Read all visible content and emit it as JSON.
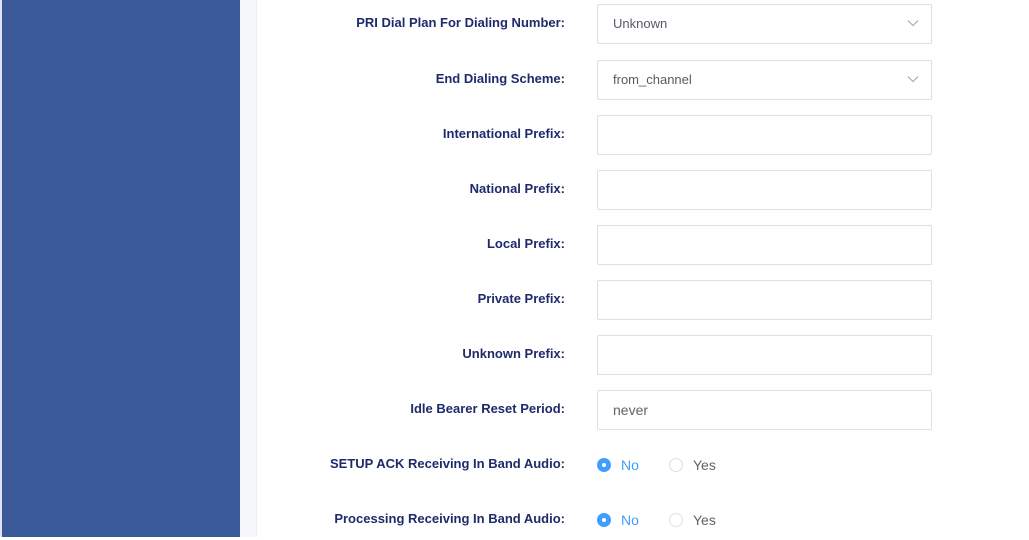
{
  "colors": {
    "sidebar": "#3a5998",
    "label": "#1f2a6b",
    "accent": "#409eff",
    "border": "#dcdfe6"
  },
  "form": {
    "dial_plan": {
      "label": "PRI Dial Plan For Dialing Number:",
      "value": "Unknown"
    },
    "end_scheme": {
      "label": "End Dialing Scheme:",
      "value": "from_channel"
    },
    "intl_prefix": {
      "label": "International Prefix:",
      "value": ""
    },
    "national_prefix": {
      "label": "National Prefix:",
      "value": ""
    },
    "local_prefix": {
      "label": "Local Prefix:",
      "value": ""
    },
    "private_prefix": {
      "label": "Private Prefix:",
      "value": ""
    },
    "unknown_prefix": {
      "label": "Unknown Prefix:",
      "value": ""
    },
    "idle_bearer": {
      "label": "Idle Bearer Reset Period:",
      "value": "never"
    },
    "setup_ack": {
      "label": "SETUP ACK Receiving In Band Audio:",
      "no": "No",
      "yes": "Yes",
      "selected": "No"
    },
    "processing": {
      "label": "Processing Receiving In Band Audio:",
      "no": "No",
      "yes": "Yes",
      "selected": "No"
    }
  }
}
